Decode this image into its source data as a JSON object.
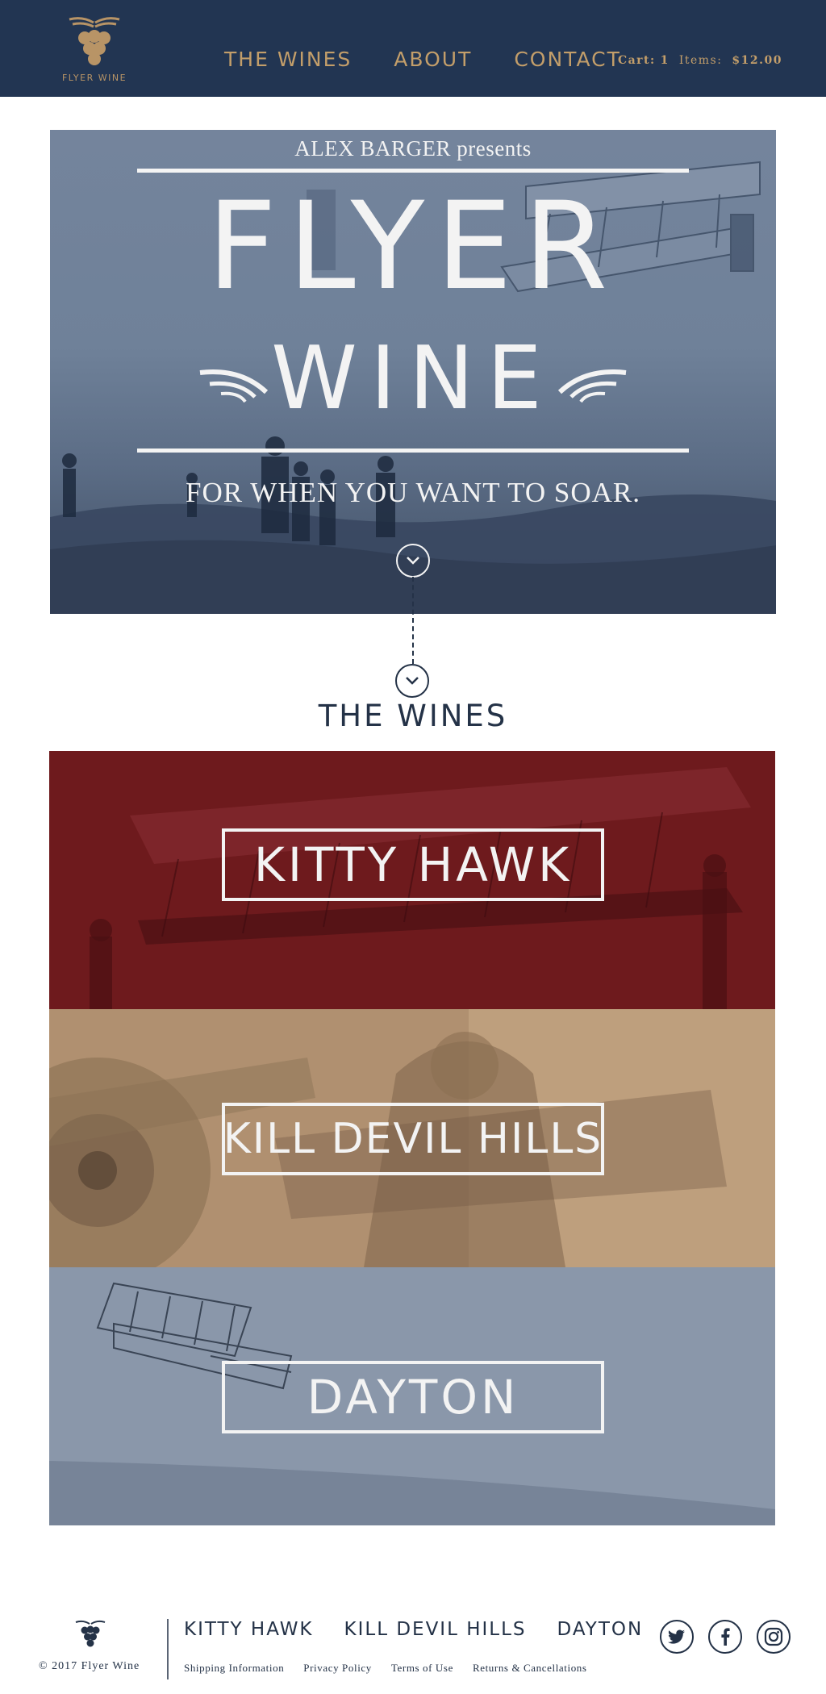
{
  "header": {
    "logo_text": "FLYER WINE",
    "nav": [
      "THE WINES",
      "ABOUT",
      "CONTACT"
    ],
    "cart": {
      "label": "Cart:",
      "count": "1",
      "items_label": "Items:",
      "total": "$12.00"
    }
  },
  "hero": {
    "presents": "ALEX BARGER presents",
    "title": "FLYER",
    "subtitle": "WINE",
    "tagline": "FOR WHEN YOU WANT TO SOAR."
  },
  "wines_section": {
    "title": "THE WINES",
    "wines": [
      {
        "name": "KITTY HAWK",
        "color": "#6e1a1d"
      },
      {
        "name": "KILL DEVIL HILLS",
        "color": "#b09070"
      },
      {
        "name": "DAYTON",
        "color": "#8a97aa"
      }
    ]
  },
  "footer": {
    "copyright": "© 2017 Flyer Wine",
    "wines": [
      "KITTY HAWK",
      "KILL DEVIL HILLS",
      "DAYTON"
    ],
    "links": [
      "Shipping Information",
      "Privacy Policy",
      "Terms of Use",
      "Returns & Cancellations"
    ],
    "social": [
      "twitter-icon",
      "facebook-icon",
      "instagram-icon"
    ]
  },
  "colors": {
    "navy": "#223552",
    "gold": "#c39e6a",
    "text": "#243247"
  }
}
